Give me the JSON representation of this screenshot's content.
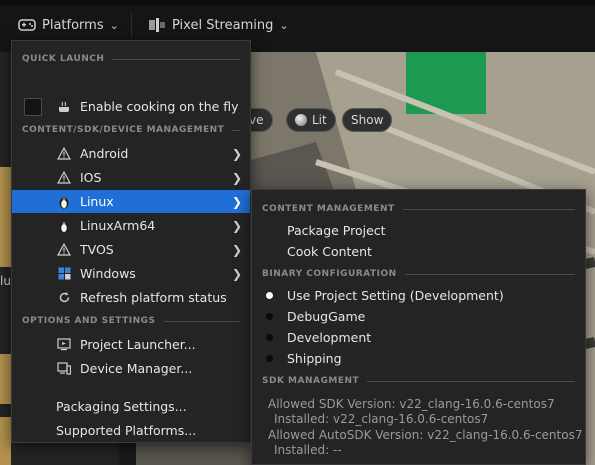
{
  "toolbar": {
    "platforms_label": "Platforms",
    "pixel_streaming_label": "Pixel Streaming"
  },
  "viewport": {
    "chip_lit_label": "Lit",
    "chip_show_label": "Show",
    "chip_partial_label": "tive",
    "side_text": "lu"
  },
  "menu": {
    "quick_launch_header": "QUICK LAUNCH",
    "enable_cooking_label": "Enable cooking on the fly",
    "content_header": "CONTENT/SDK/DEVICE MANAGEMENT",
    "platforms": [
      {
        "label": "Android",
        "icon": "warning-icon"
      },
      {
        "label": "IOS",
        "icon": "warning-icon"
      },
      {
        "label": "Linux",
        "icon": "linux-icon"
      },
      {
        "label": "LinuxArm64",
        "icon": "linux-icon"
      },
      {
        "label": "TVOS",
        "icon": "warning-icon"
      },
      {
        "label": "Windows",
        "icon": "windows-icon"
      }
    ],
    "refresh_label": "Refresh platform status",
    "options_header": "OPTIONS AND SETTINGS",
    "project_launcher_label": "Project Launcher...",
    "device_manager_label": "Device Manager...",
    "packaging_settings_label": "Packaging Settings...",
    "supported_platforms_label": "Supported Platforms..."
  },
  "submenu": {
    "content_header": "CONTENT MANAGEMENT",
    "package_project_label": "Package Project",
    "cook_content_label": "Cook Content",
    "binary_header": "BINARY CONFIGURATION",
    "configs": [
      {
        "label": "Use Project Setting (Development)",
        "selected": true
      },
      {
        "label": "DebugGame",
        "selected": false
      },
      {
        "label": "Development",
        "selected": false
      },
      {
        "label": "Shipping",
        "selected": false
      }
    ],
    "sdk_header": "SDK MANAGMENT",
    "sdk_lines": [
      "Allowed SDK Version: v22_clang-16.0.6-centos7",
      "Installed: v22_clang-16.0.6-centos7",
      "Allowed AutoSDK Version: v22_clang-16.0.6-centos7",
      "Installed: --"
    ]
  },
  "colors": {
    "highlight": "#1f6fd6",
    "menu_bg": "#242424"
  }
}
